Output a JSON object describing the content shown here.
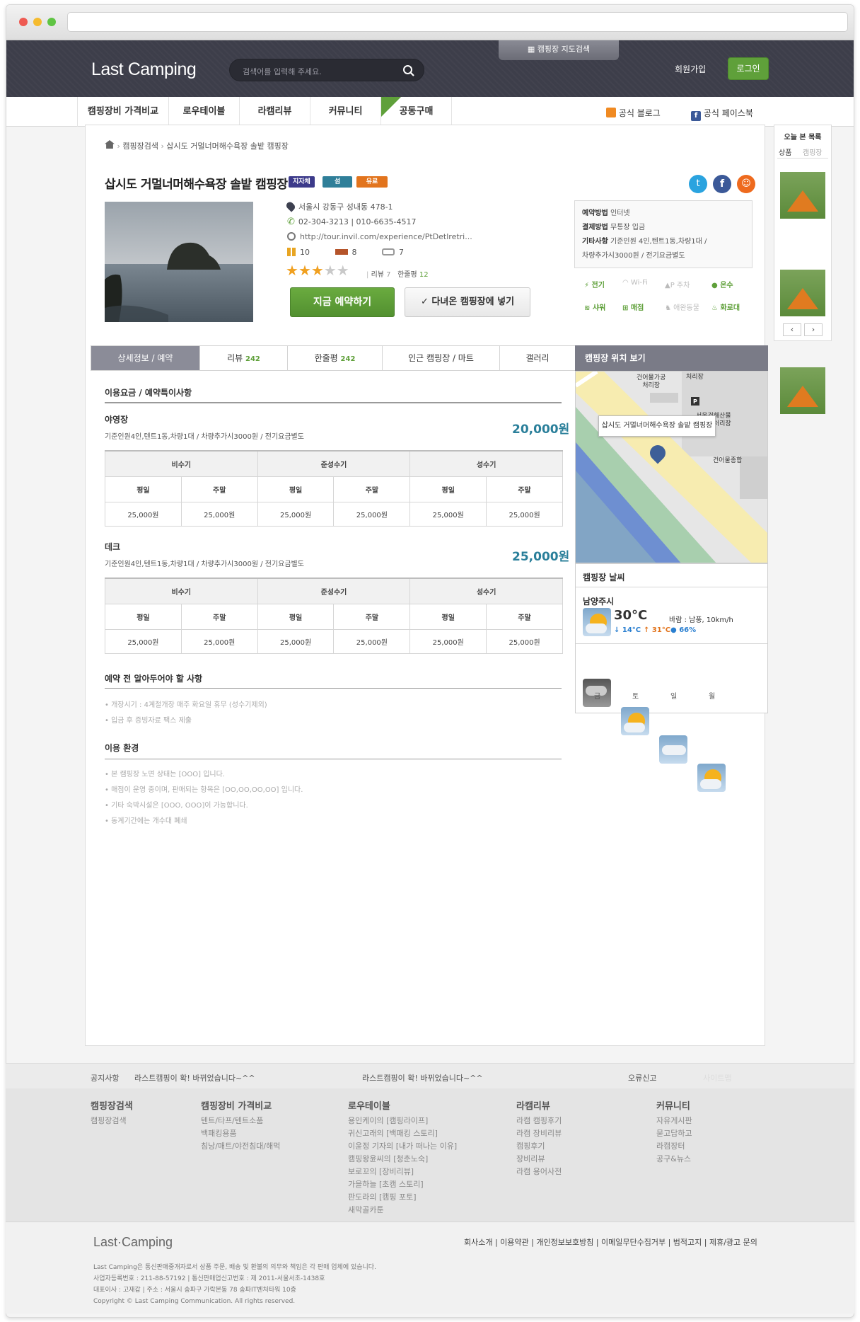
{
  "header": {
    "logo": "Last Camping",
    "search_placeholder": "검색어를 입력해 주세요.",
    "map_search": "캠핑장 지도검색",
    "join": "회원가입",
    "login": "로그인"
  },
  "nav": {
    "items": [
      "캠핑장비 가격비교",
      "로우테이블",
      "라캠리뷰",
      "커뮤니티",
      "공동구매"
    ],
    "new_badge": "NEW",
    "blog": "공식 블로그",
    "facebook": "공식 페이스북"
  },
  "today": {
    "title": "오늘 본 목록",
    "tab_products": "상품",
    "tab_camps": "캠핑장"
  },
  "breadcrumb": [
    "캠핑장검색",
    "삽시도 거멀너머해수욕장 솔밭 캠핑장"
  ],
  "camp": {
    "name": "삽시도 거멀너머해수욕장 솔밭 캠핑장",
    "badges": [
      {
        "label": "지자체",
        "color": "#3c3a8a"
      },
      {
        "label": "섬",
        "color": "#2f7f99"
      },
      {
        "label": "유료",
        "color": "#e2741d"
      }
    ],
    "address": "서울시 강동구 성내동 478-1",
    "phone": "02-304-3213 | 010-6635-4517",
    "url": "http://tour.invil.com/experience/PtDetlretri...",
    "sites": "10",
    "decks": "8",
    "caravans": "7",
    "rating": 3,
    "rating_max": 5,
    "review_label": "리뷰",
    "review_count": "7",
    "oneline_label": "한줄평",
    "oneline_count": "12",
    "reserve_btn": "지금 예약하기",
    "visited_btn": "✓ 다녀온 캠핑장에 넣기"
  },
  "reservation_box": {
    "method_label": "예약방법",
    "method": "인터넷",
    "payment_label": "결제방법",
    "payment": "무통장 입금",
    "etc_label": "기타사항",
    "etc": "기준인원 4인,텐트1동,차량1대 /",
    "etc2": "차량추가시3000원 / 전기요금별도"
  },
  "amenities": [
    {
      "label": "전기",
      "on": true
    },
    {
      "label": "Wi-Fi",
      "on": false
    },
    {
      "label": "주차",
      "on": false
    },
    {
      "label": "온수",
      "on": true
    },
    {
      "label": "샤워",
      "on": true
    },
    {
      "label": "매점",
      "on": true
    },
    {
      "label": "애완동물",
      "on": false
    },
    {
      "label": "화로대",
      "on": true
    }
  ],
  "tabs": [
    {
      "label": "상세정보 / 예약",
      "count": ""
    },
    {
      "label": "리뷰",
      "count": "242"
    },
    {
      "label": "한줄평",
      "count": "242"
    },
    {
      "label": "인근 캠핑장 / 마트",
      "count": ""
    },
    {
      "label": "갤러리",
      "count": ""
    }
  ],
  "map": {
    "title": "캠핑장 위치 보기",
    "popup": "삽시도 거멀너머해수욕장 솔밭 캠핑장",
    "labels": [
      "건어물가공",
      "처리장",
      "처리장",
      "서울건해산물",
      "처리장",
      "건어물종합"
    ],
    "parking": "P"
  },
  "pricing": {
    "title": "이용요금 / 예약특이사항",
    "seasons": [
      "비수기",
      "준성수기",
      "성수기"
    ],
    "days": [
      "평일",
      "주말",
      "평일",
      "주말",
      "평일",
      "주말"
    ],
    "sections": [
      {
        "name": "야영장",
        "desc": "기준인원4인,텐트1동,차량1대 / 차량추가시3000원 / 전기요금별도",
        "price": "20,000원",
        "values": [
          "25,000원",
          "25,000원",
          "25,000원",
          "25,000원",
          "25,000원",
          "25,000원"
        ]
      },
      {
        "name": "데크",
        "desc": "기준인원4인,텐트1동,차량1대 / 차량추가시3000원 / 전기요금별도",
        "price": "25,000원",
        "values": [
          "25,000원",
          "25,000원",
          "25,000원",
          "25,000원",
          "25,000원",
          "25,000원"
        ]
      }
    ]
  },
  "notice": {
    "title": "예약 전 알아두어야 할 사항",
    "items": [
      "개장시기 : 4계절개장 매주 화요일 휴무 (성수기제외)",
      "입금 후 증빙자료 팩스 제출"
    ]
  },
  "environment": {
    "title": "이용 환경",
    "items": [
      "본 캠핑장 노면 상태는 [OOO] 입니다.",
      "매점이 운영 중이며, 판매되는 항목은 [OO,OO,OO,OO] 입니다.",
      "기타 숙박시설은 [OOO, OOO]이 가능합니다.",
      "동계기간에는 개수대 폐쇄"
    ]
  },
  "weather": {
    "title": "캠핑장 날씨",
    "city": "남양주시",
    "temp": "30°C",
    "wind": "바람 : 남풍, 10km/h",
    "low": "↓ 14°C",
    "high": "↑ 31°C",
    "humidity": "66%",
    "forecast": [
      "금",
      "토",
      "일",
      "월"
    ]
  },
  "footer": {
    "notice_label": "공지사항",
    "notice1": "라스트캠핑이 확! 바뀌었습니다~^^",
    "notice2": "라스트캠핑이 확! 바뀌었습니다~^^",
    "report": "오류신고",
    "sitemap": "사이트맵",
    "columns": [
      {
        "head": "캠핑장검색",
        "items": [
          "캠핑장검색"
        ]
      },
      {
        "head": "캠핑장비 가격비교",
        "items": [
          "텐트/타프/텐트소품",
          "백패킹용품",
          "침낭/매트/야전침대/해먹"
        ]
      },
      {
        "head": "로우테이블",
        "items": [
          "용인케이의 [캠핑라이프]",
          "귀신고래의 [백패킹 스토리]",
          "이윤정 기자의 [내가 떠나는 이유]",
          "캠핑왕윤씨의 [청춘노숙]",
          "보로꼬의 [장비리뷰]",
          "가을하늘 [초캠 스토리]",
          "판도라의 [캠핑 포토]",
          "새막골카툰"
        ]
      },
      {
        "head": "라캠리뷰",
        "items": [
          "라캠 캠핑후기",
          "라캠 장비리뷰",
          "캠핑후기",
          "장비리뷰",
          "라캠 용어사전"
        ]
      },
      {
        "head": "커뮤니티",
        "items": [
          "자유게시판",
          "묻고답하고",
          "라캠장터",
          "공구&뉴스"
        ]
      }
    ],
    "logo": "Last·Camping",
    "links": "회사소개 | 이용약관 | 개인정보보호방침 | 이메일무단수집거부 | 법적고지 | 제휴/광고 문의",
    "info": [
      "Last Camping은 통신판매중개자로서 상품 주문, 배송 및 환불의 의무와 책임은 각 판매 업체에 있습니다.",
      "사업자등록번호 : 211-88-57192 | 통신판매업신고번호 : 제 2011-서울서초-1438호",
      "대표이사 : 고재갑 | 주소 : 서울시 송파구 가락본동 78 송파IT벤처타워 10층",
      "Copyright © Last Camping Communication. All rights reserved."
    ]
  }
}
